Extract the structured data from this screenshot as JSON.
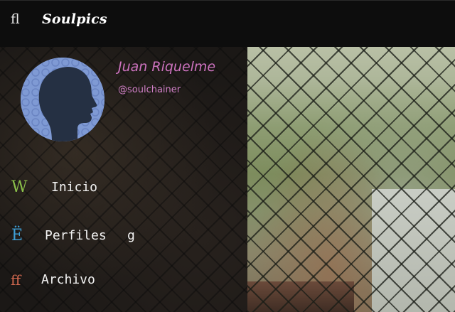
{
  "header": {
    "menu_icon_glyph": "ﬂ",
    "brand": "Soulpics"
  },
  "profile": {
    "name": "Juan Riquelme",
    "handle": "@soulchainer",
    "name_color": "#cc72be"
  },
  "nav": {
    "items": [
      {
        "icon": "W",
        "icon_name": "home-icon",
        "icon_color": "#8bbf4a",
        "label": "Inicio",
        "extra": ""
      },
      {
        "icon": "Ë",
        "icon_name": "profiles-icon",
        "icon_color": "#3f9fd6",
        "label": "Perfiles",
        "extra": "g"
      },
      {
        "icon": "ﬀ",
        "icon_name": "archive-icon",
        "icon_color": "#d1684f",
        "label": "Archivo",
        "extra": ""
      }
    ]
  }
}
